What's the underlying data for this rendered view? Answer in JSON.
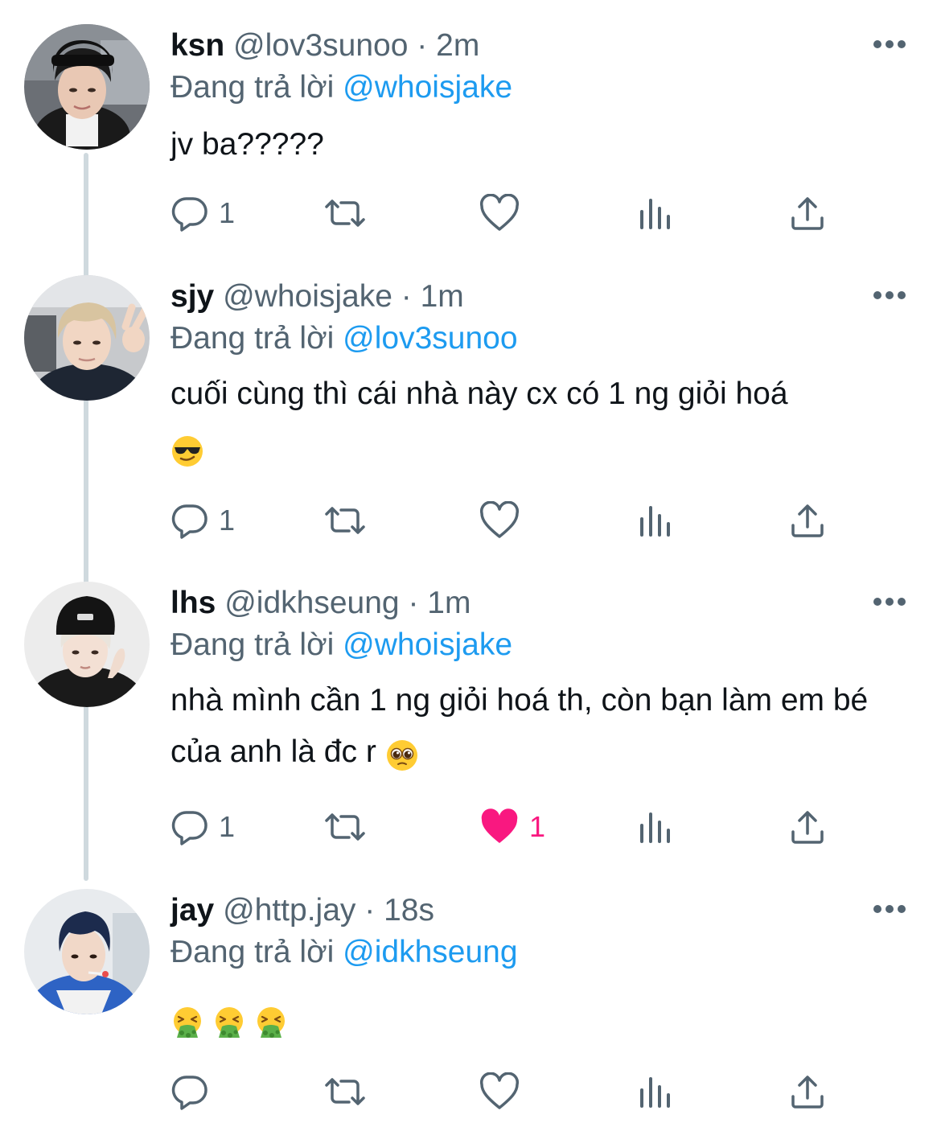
{
  "tweets": [
    {
      "name": "ksn",
      "handle": "@lov3sunoo",
      "time": "2m",
      "replying_prefix": "Đang trả lời",
      "replying_to": "@whoisjake",
      "text": "jv ba?????",
      "reply_count": "1",
      "like_count": "",
      "liked": false
    },
    {
      "name": "sjy",
      "handle": "@whoisjake",
      "time": "1m",
      "replying_prefix": "Đang trả lời",
      "replying_to": "@lov3sunoo",
      "text": "cuối cùng thì cái nhà này cx có 1 ng giỏi hoá",
      "text_emoji": "sunglasses-face",
      "reply_count": "1",
      "like_count": "",
      "liked": false
    },
    {
      "name": "lhs",
      "handle": "@idkhseung",
      "time": "1m",
      "replying_prefix": "Đang trả lời",
      "replying_to": "@whoisjake",
      "text": "nhà mình cần 1 ng giỏi hoá th, còn bạn làm em bé của anh là đc r",
      "text_emoji": "pleading-face",
      "reply_count": "1",
      "like_count": "1",
      "liked": true
    },
    {
      "name": "jay",
      "handle": "@http.jay",
      "time": "18s",
      "replying_prefix": "Đang trả lời",
      "replying_to": "@idkhseung",
      "text": "",
      "text_emoji": "vomiting-face x3",
      "reply_count": "",
      "like_count": "",
      "liked": false
    }
  ],
  "separator": "·",
  "colors": {
    "text": "#0f1419",
    "secondary": "#536471",
    "link": "#1d9bf0",
    "like": "#f91880",
    "thread_line": "#cfd9de"
  },
  "icons": [
    "reply-icon",
    "retweet-icon",
    "like-icon",
    "views-icon",
    "share-icon",
    "more-icon"
  ]
}
